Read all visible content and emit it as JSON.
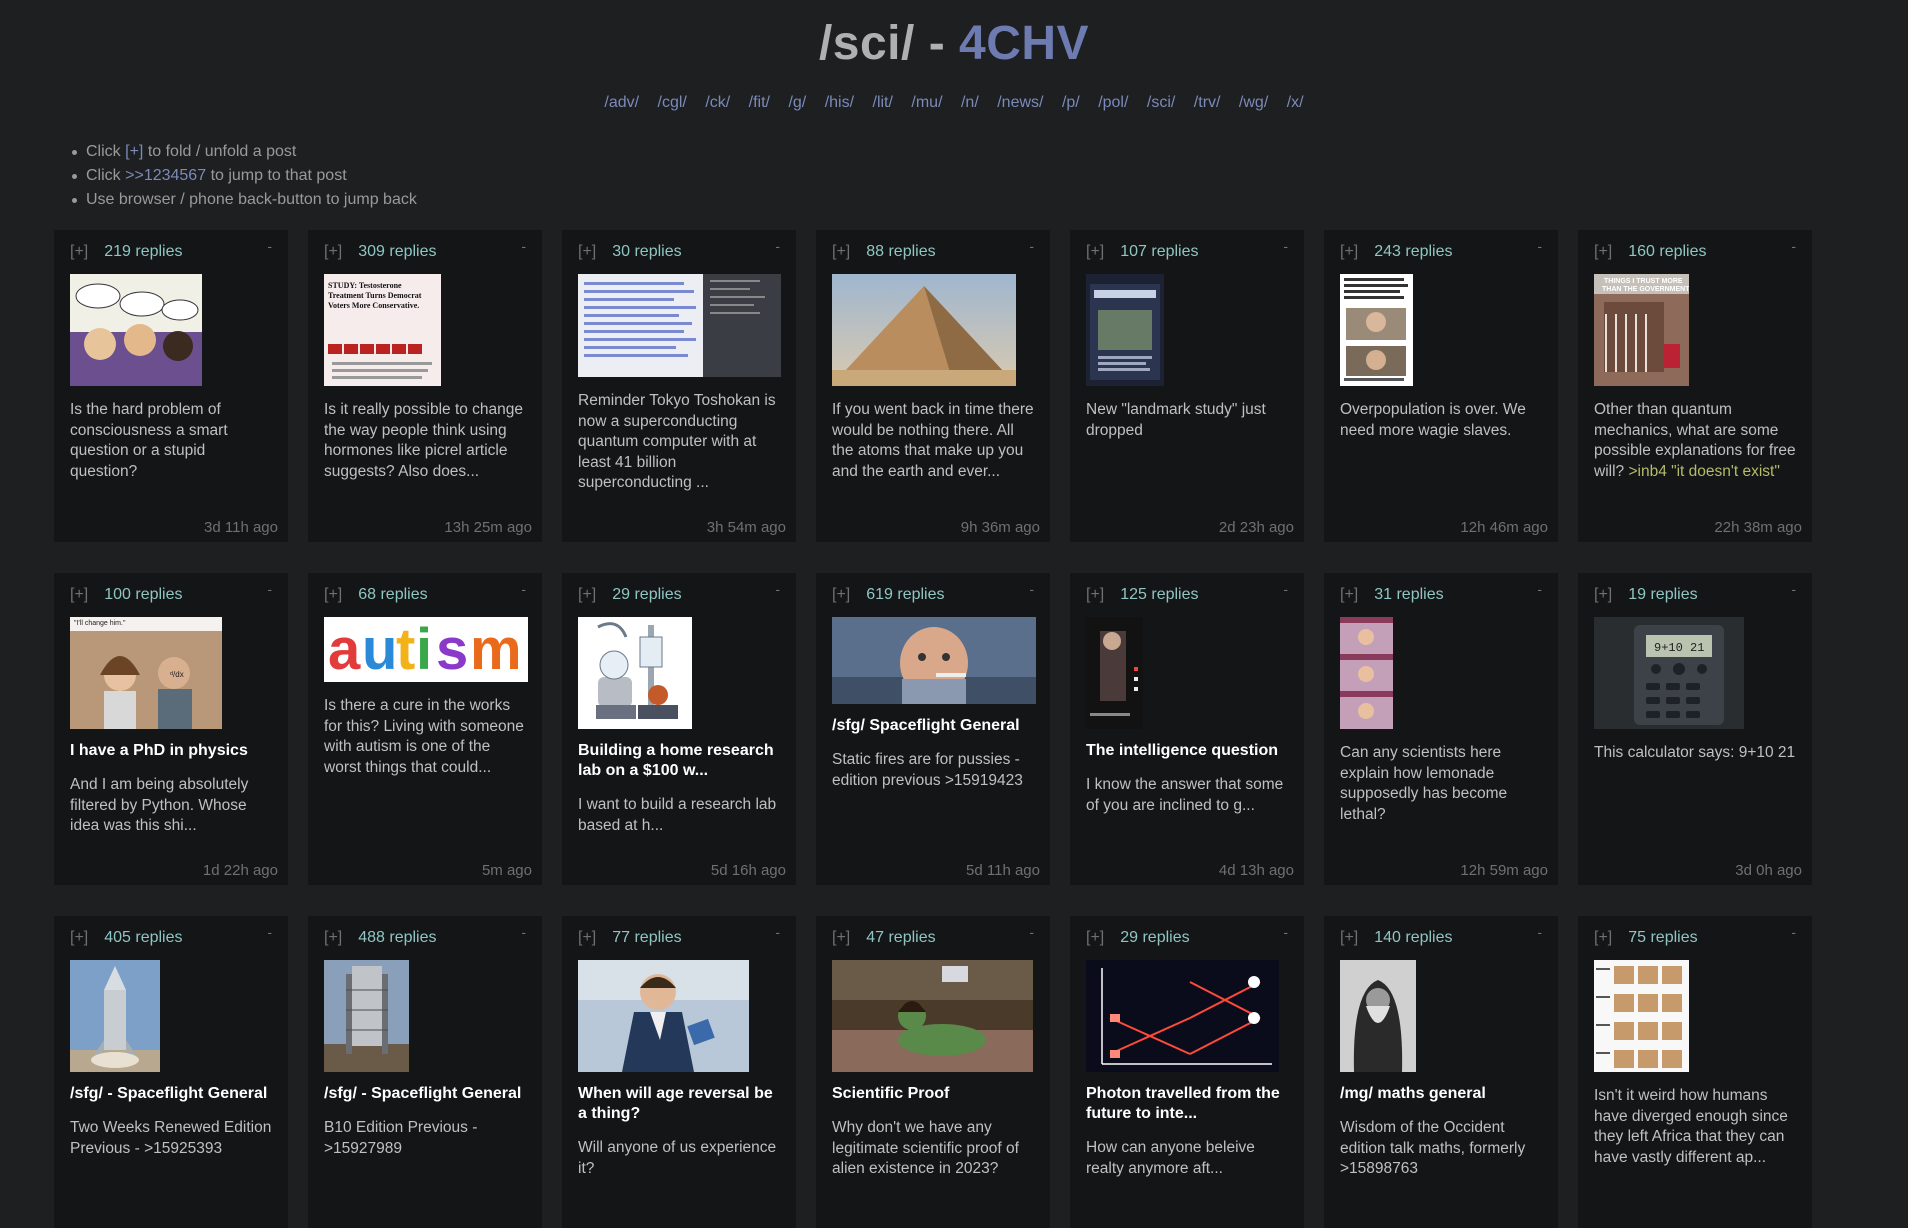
{
  "header": {
    "board": "/sci/",
    "separator": "-",
    "brand": "4CHV"
  },
  "nav": [
    "/adv/",
    "/cgl/",
    "/ck/",
    "/fit/",
    "/g/",
    "/his/",
    "/lit/",
    "/mu/",
    "/n/",
    "/news/",
    "/p/",
    "/pol/",
    "/sci/",
    "/trv/",
    "/wg/",
    "/x/"
  ],
  "help": {
    "line1_pre": "Click",
    "line1_link": "[+]",
    "line1_post": "to fold / unfold a post",
    "line2_pre": "Click",
    "line2_link": ">>1234567",
    "line2_post": "to jump to that post",
    "line3": "Use browser / phone back-button to jump back"
  },
  "fold_label": "[+]",
  "dash": "-",
  "threads": [
    {
      "replies": "219 replies",
      "subject": "",
      "body": "Is the hard problem of consciousness a smart question or a stupid question?",
      "green": "",
      "time": "3d 11h ago",
      "thumb_icon": "comic-thumbnail"
    },
    {
      "replies": "309 replies",
      "subject": "",
      "body": "Is it really possible to change the way people think using hormones like picrel article suggests? Also does...",
      "green": "",
      "time": "13h 25m ago",
      "thumb_icon": "article-thumbnail"
    },
    {
      "replies": "30 replies",
      "subject": "",
      "body": "Reminder Tokyo Toshokan is now a superconducting quantum computer with at least 41 billion superconducting ...",
      "green": "",
      "time": "3h 54m ago",
      "thumb_icon": "screenshot-thumbnail"
    },
    {
      "replies": "88 replies",
      "subject": "",
      "body": "If you went back in time there would be nothing there. All the atoms that make up you and the earth and ever...",
      "green": "",
      "time": "9h 36m ago",
      "thumb_icon": "pyramid-thumbnail"
    },
    {
      "replies": "107 replies",
      "subject": "",
      "body": "New \"landmark study\" just dropped",
      "green": "",
      "time": "2d 23h ago",
      "thumb_icon": "news-thumbnail"
    },
    {
      "replies": "243 replies",
      "subject": "",
      "body": "Overpopulation is over. We need more wagie slaves.",
      "green": "",
      "time": "12h 46m ago",
      "thumb_icon": "tweet-thumbnail"
    },
    {
      "replies": "160 replies",
      "subject": "",
      "body": "Other than quantum mechanics, what are some possible explanations for free will? ",
      "green": ">inb4 \"it doesn't exist\"",
      "time": "22h 38m ago",
      "thumb_icon": "meme-thumbnail"
    },
    {
      "replies": "100 replies",
      "subject": "I have a PhD in physics",
      "body": "And I am being absolutely filtered by Python. Whose idea was this shi...",
      "green": "",
      "time": "1d 22h ago",
      "thumb_icon": "couple-thumbnail"
    },
    {
      "replies": "68 replies",
      "subject": "",
      "body": "Is there a cure in the works for this? Living with someone with autism is one of the worst things that could...",
      "green": "",
      "time": "5m ago",
      "thumb_icon": "autism-text-thumbnail",
      "thumb_text": "autism"
    },
    {
      "replies": "29 replies",
      "subject": "Building a home research lab on a $100 w...",
      "body": "I want to build a research lab based at h...",
      "green": "",
      "time": "5d 16h ago",
      "thumb_icon": "lab-equipment-thumbnail"
    },
    {
      "replies": "619 replies",
      "subject": "/sfg/ Spaceflight General",
      "body": "Static fires are for pussies - edition previous >15919423",
      "green": "",
      "time": "5d 11h ago",
      "thumb_icon": "portrait-thumbnail"
    },
    {
      "replies": "125 replies",
      "subject": "The intelligence question",
      "body": "I know the answer that some of you are inclined to g...",
      "green": "",
      "time": "4d 13h ago",
      "thumb_icon": "phone-video-thumbnail"
    },
    {
      "replies": "31 replies",
      "subject": "",
      "body": "Can any scientists here explain how lemonade supposedly has become lethal?",
      "green": "",
      "time": "12h 59m ago",
      "thumb_icon": "collage-thumbnail"
    },
    {
      "replies": "19 replies",
      "subject": "",
      "body": "This calculator says: 9+10 21",
      "green": "",
      "time": "3d 0h ago",
      "thumb_icon": "calculator-thumbnail"
    },
    {
      "replies": "405 replies",
      "subject": "/sfg/ - Spaceflight General",
      "body": "Two Weeks Renewed Edition Previous - >15925393",
      "green": "",
      "time": "",
      "thumb_icon": "rocket-thumbnail"
    },
    {
      "replies": "488 replies",
      "subject": "/sfg/ - Spaceflight General",
      "body": "B10 Edition Previous - >15927989",
      "green": "",
      "time": "",
      "thumb_icon": "launchpad-thumbnail"
    },
    {
      "replies": "77 replies",
      "subject": "When will age reversal be a thing?",
      "body": "Will anyone of us experience it?",
      "green": "",
      "time": "",
      "thumb_icon": "man-suit-thumbnail"
    },
    {
      "replies": "47 replies",
      "subject": "Scientific Proof",
      "body": "Why don't we have any legitimate scientific proof of alien existence in 2023?",
      "green": "",
      "time": "",
      "thumb_icon": "green-figure-thumbnail"
    },
    {
      "replies": "29 replies",
      "subject": "Photon travelled from the future to inte...",
      "body": "How can anyone beleive realty anymore aft...",
      "green": "",
      "time": "",
      "thumb_icon": "laser-diagram-thumbnail"
    },
    {
      "replies": "140 replies",
      "subject": "/mg/ maths general",
      "body": "Wisdom of the Occident edition talk maths, formerly >15898763",
      "green": "",
      "time": "",
      "thumb_icon": "monk-thumbnail"
    },
    {
      "replies": "75 replies",
      "subject": "",
      "body": "Isn't it weird how humans have diverged enough since they left Africa that they can have vastly different ap...",
      "green": "",
      "time": "",
      "thumb_icon": "faces-chart-thumbnail"
    }
  ]
}
